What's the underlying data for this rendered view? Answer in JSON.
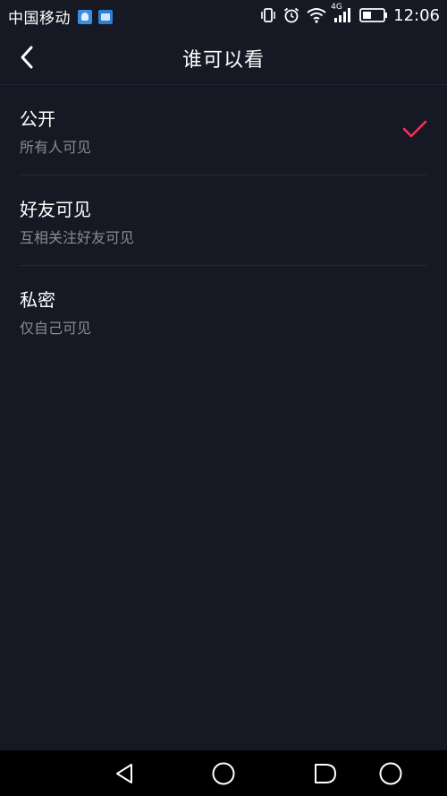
{
  "status_bar": {
    "carrier": "中国移动",
    "network": "4G",
    "time": "12:06"
  },
  "header": {
    "title": "谁可以看"
  },
  "options": [
    {
      "title": "公开",
      "subtitle": "所有人可见",
      "selected": true
    },
    {
      "title": "好友可见",
      "subtitle": "互相关注好友可见",
      "selected": false
    },
    {
      "title": "私密",
      "subtitle": "仅自己可见",
      "selected": false
    }
  ],
  "colors": {
    "background": "#161823",
    "accent": "#fe2c55",
    "subtitle": "#8a8b91"
  },
  "icons": {
    "back": "chevron-left-icon",
    "check": "check-icon",
    "nav_back": "triangle-back-icon",
    "nav_home": "circle-home-icon",
    "nav_recents": "recents-icon",
    "nav_assist": "circle-icon"
  }
}
